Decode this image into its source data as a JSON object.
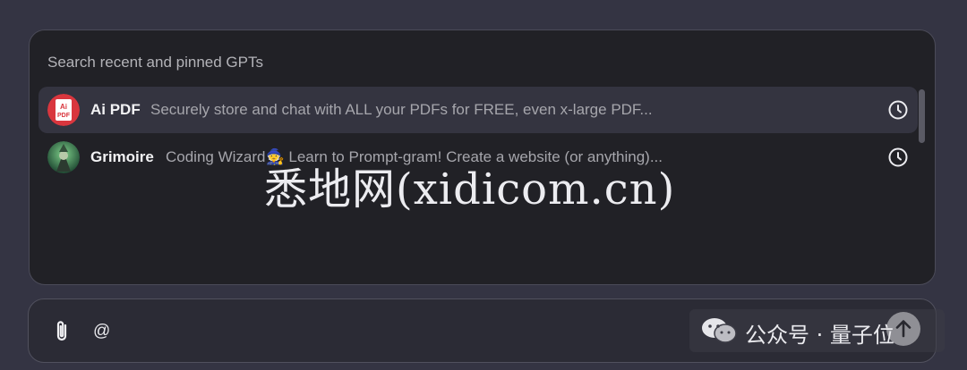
{
  "popup": {
    "search_label": "Search recent and pinned GPTs",
    "items": [
      {
        "name": "Ai PDF",
        "description": "Securely store and chat with ALL your PDFs for FREE, even x-large PDF...",
        "icon": "ai-pdf-logo",
        "avatar_text": "Ai\nPDF",
        "trailing_icon": "clock-icon",
        "selected": true
      },
      {
        "name": "Grimoire",
        "description": "Coding Wizard🧙 Learn to Prompt-gram! Create a website (or anything)...",
        "icon": "grimoire-wizard-avatar",
        "trailing_icon": "clock-icon",
        "selected": false
      }
    ]
  },
  "composer": {
    "value": "@",
    "attach_icon": "paperclip-icon",
    "send_icon": "arrow-up-icon"
  },
  "watermarks": {
    "main": "悉地网(xidicom.cn)",
    "wechat": "公众号 · 量子位"
  },
  "colors": {
    "background": "#343443",
    "popup_bg": "#212126",
    "selected_row": "#343440",
    "pdf_red": "#d9363e"
  }
}
